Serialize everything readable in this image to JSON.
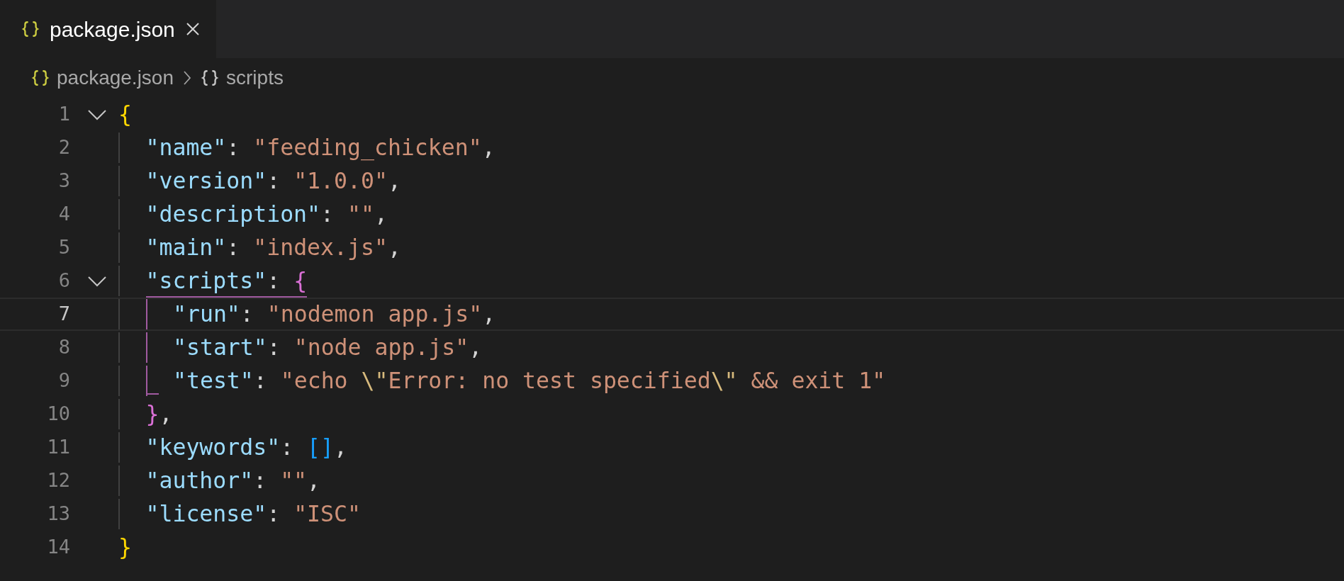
{
  "tabs": [
    {
      "label": "package.json",
      "selected": true,
      "closable": true
    }
  ],
  "breadcrumb": [
    {
      "kind": "file",
      "label": "package.json"
    },
    {
      "kind": "object",
      "label": "scripts"
    }
  ],
  "code": [
    {
      "number": "1",
      "foldable": true,
      "current": false,
      "active_bracket": false,
      "tokens": [
        {
          "kind": "brace-outer",
          "text": "{"
        }
      ],
      "children": [
        {
          "number": "2",
          "foldable": false,
          "current": false,
          "active_bracket": false,
          "tokens": [
            {
              "kind": "key",
              "text": "\"name\""
            },
            {
              "kind": "punct",
              "text": ": "
            },
            {
              "kind": "string",
              "text": "\"feeding_chicken\""
            },
            {
              "kind": "punct",
              "text": ","
            }
          ]
        },
        {
          "number": "3",
          "foldable": false,
          "current": false,
          "active_bracket": false,
          "tokens": [
            {
              "kind": "key",
              "text": "\"version\""
            },
            {
              "kind": "punct",
              "text": ": "
            },
            {
              "kind": "string",
              "text": "\"1.0.0\""
            },
            {
              "kind": "punct",
              "text": ","
            }
          ]
        },
        {
          "number": "4",
          "foldable": false,
          "current": false,
          "active_bracket": false,
          "tokens": [
            {
              "kind": "key",
              "text": "\"description\""
            },
            {
              "kind": "punct",
              "text": ": "
            },
            {
              "kind": "string",
              "text": "\"\""
            },
            {
              "kind": "punct",
              "text": ","
            }
          ]
        },
        {
          "number": "5",
          "foldable": false,
          "current": false,
          "active_bracket": false,
          "tokens": [
            {
              "kind": "key",
              "text": "\"main\""
            },
            {
              "kind": "punct",
              "text": ": "
            },
            {
              "kind": "string",
              "text": "\"index.js\""
            },
            {
              "kind": "punct",
              "text": ","
            }
          ]
        },
        {
          "number": "6",
          "foldable": true,
          "current": false,
          "active_bracket": true,
          "tokens": [
            {
              "kind": "key",
              "text": "\"scripts\""
            },
            {
              "kind": "punct",
              "text": ": "
            },
            {
              "kind": "brace-inner",
              "text": "{"
            }
          ],
          "children": [
            {
              "number": "7",
              "foldable": false,
              "current": true,
              "active_bracket": false,
              "tokens": [
                {
                  "kind": "key",
                  "text": "\"run\""
                },
                {
                  "kind": "punct",
                  "text": ": "
                },
                {
                  "kind": "string",
                  "text": "\"nodemon app.js\""
                },
                {
                  "kind": "punct",
                  "text": ","
                }
              ]
            },
            {
              "number": "8",
              "foldable": false,
              "current": false,
              "active_bracket": false,
              "tokens": [
                {
                  "kind": "key",
                  "text": "\"start\""
                },
                {
                  "kind": "punct",
                  "text": ": "
                },
                {
                  "kind": "string",
                  "text": "\"node app.js\""
                },
                {
                  "kind": "punct",
                  "text": ","
                }
              ]
            },
            {
              "number": "9",
              "foldable": false,
              "current": false,
              "active_bracket": false,
              "tokens": [
                {
                  "kind": "key",
                  "text": "\"test\""
                },
                {
                  "kind": "punct",
                  "text": ": "
                },
                {
                  "kind": "string",
                  "text": "\"echo "
                },
                {
                  "kind": "escape",
                  "text": "\\\""
                },
                {
                  "kind": "string",
                  "text": "Error: no test specified"
                },
                {
                  "kind": "escape",
                  "text": "\\\""
                },
                {
                  "kind": "string",
                  "text": " && exit 1\""
                }
              ]
            }
          ]
        },
        {
          "number": "10",
          "foldable": false,
          "current": false,
          "active_bracket": false,
          "tokens": [
            {
              "kind": "brace-inner",
              "text": "}"
            },
            {
              "kind": "punct",
              "text": ","
            }
          ]
        },
        {
          "number": "11",
          "foldable": false,
          "current": false,
          "active_bracket": false,
          "tokens": [
            {
              "kind": "key",
              "text": "\"keywords\""
            },
            {
              "kind": "punct",
              "text": ": "
            },
            {
              "kind": "bracket",
              "text": "[]"
            },
            {
              "kind": "punct",
              "text": ","
            }
          ]
        },
        {
          "number": "12",
          "foldable": false,
          "current": false,
          "active_bracket": false,
          "tokens": [
            {
              "kind": "key",
              "text": "\"author\""
            },
            {
              "kind": "punct",
              "text": ": "
            },
            {
              "kind": "string",
              "text": "\"\""
            },
            {
              "kind": "punct",
              "text": ","
            }
          ]
        },
        {
          "number": "13",
          "foldable": false,
          "current": false,
          "active_bracket": false,
          "tokens": [
            {
              "kind": "key",
              "text": "\"license\""
            },
            {
              "kind": "punct",
              "text": ": "
            },
            {
              "kind": "string",
              "text": "\"ISC\""
            }
          ]
        }
      ]
    },
    {
      "number": "14",
      "foldable": false,
      "current": false,
      "active_bracket": false,
      "tokens": [
        {
          "kind": "brace-outer",
          "text": "}"
        }
      ]
    }
  ]
}
